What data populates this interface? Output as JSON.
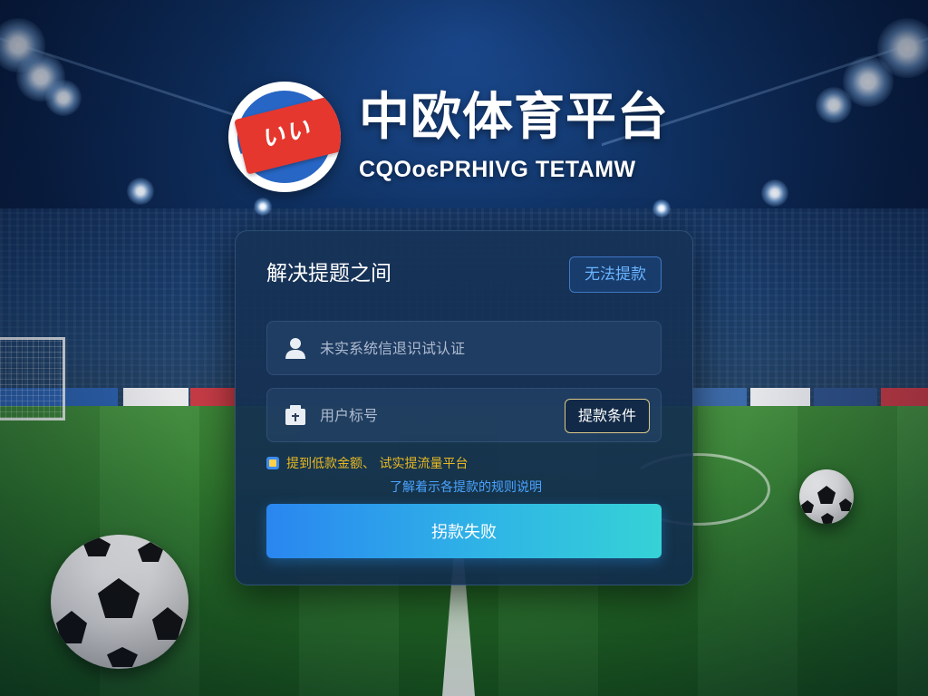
{
  "brand": {
    "title": "中欧体育平台",
    "subtitle": "CQOoєPRHIVG TETAMW",
    "badge_mark": "いい"
  },
  "card": {
    "title": "解决提题之间",
    "corner_button": "无法提款",
    "account_field": {
      "icon": "user-icon",
      "placeholder": "未实系统信退识试认证"
    },
    "password_field": {
      "icon": "document-icon",
      "placeholder": "用户标号",
      "action_button": "提款条件"
    },
    "notice": "提到低款金额、 试实提流量平台",
    "rules_link": "了解着示各提款的规则说明",
    "submit_label": "拐款失败"
  },
  "colors": {
    "accent_blue": "#4aa3ff",
    "notice_gold": "#e8b923",
    "submit_start": "#2a86f0",
    "submit_end": "#35d2d6",
    "logo_red": "#e5372e",
    "logo_blue": "#2766c4"
  }
}
